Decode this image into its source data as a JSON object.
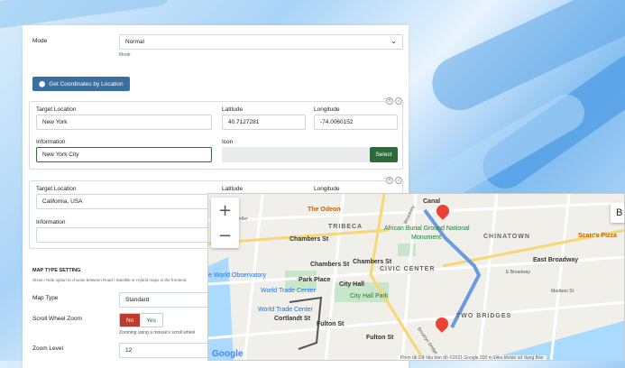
{
  "mode": {
    "label": "Mode",
    "value": "Normal",
    "help": "Mode"
  },
  "get_coords_button": "Get Coordinates by Location",
  "location1": {
    "target_label": "Target Location",
    "target_value": "New York",
    "lat_label": "Latitude",
    "lat_value": "40.7127281",
    "lng_label": "Longitude",
    "lng_value": "-74.0060152",
    "info_label": "Information",
    "info_value": "New York City",
    "icon_label": "Icon",
    "select_label": "Select"
  },
  "location2": {
    "target_label": "Target Location",
    "target_value": "California, USA",
    "lat_label": "Latitude",
    "lng_label": "Longitude",
    "info_label": "Information"
  },
  "map_type_section": {
    "heading": "MAP TYPE SETTING",
    "help": "Show / Hide option to choose between Road / Satellite or Hybrid maps in the frontend",
    "type_label": "Map Type",
    "type_value": "Standard"
  },
  "scroll_zoom": {
    "label": "Scroll Wheel Zoom",
    "no": "No",
    "yes": "Yes",
    "help": "Zooming using a mouse's scroll wheel"
  },
  "zoom_level": {
    "label": "Zoom Level",
    "value": "12"
  },
  "map": {
    "zoom_in": "+",
    "zoom_out": "−",
    "corner_btn": "B",
    "labels": {
      "odeon": "The Odeon",
      "tribeca": "TRIBECA",
      "chambers1": "Chambers St",
      "chambers2": "Chambers St",
      "chambers3": "Chambers St",
      "african": "African Burial Ground National",
      "monument": "Monument",
      "chinatown": "CHINATOWN",
      "scarfs": "Scarr's Pizza",
      "eastbroadway": "East Broadway",
      "ebroadway": "E Broadway",
      "observatory": "e World Observatory",
      "parkplace": "Park Place",
      "wtc1": "World Trade Center",
      "wtc2": "World Trade Center",
      "cityhall": "City Hall Park",
      "cityhall2": "City Hall",
      "civic": "CIVIC CENTER",
      "cortlandt": "Cortlandt St",
      "fulton1": "Fulton St",
      "fulton2": "Fulton St",
      "twobridges": "TWO BRIDGES",
      "canal": "Canal",
      "feller": "efeller",
      "rk": "rk",
      "madison": "Madison St",
      "broadway": "Broadway",
      "brooklyn": "Brooklyn Bridge",
      "google": "Google",
      "footer": "Phím tắt  Dữ liệu bản đồ ©2021 Google   200 m        Điều khoản sử dụng  Báo"
    }
  },
  "colors": {
    "button_blue": "#3a6fa0",
    "button_green": "#2d6a3a",
    "route": "#6a9ae0",
    "marker": "#ea4335"
  }
}
